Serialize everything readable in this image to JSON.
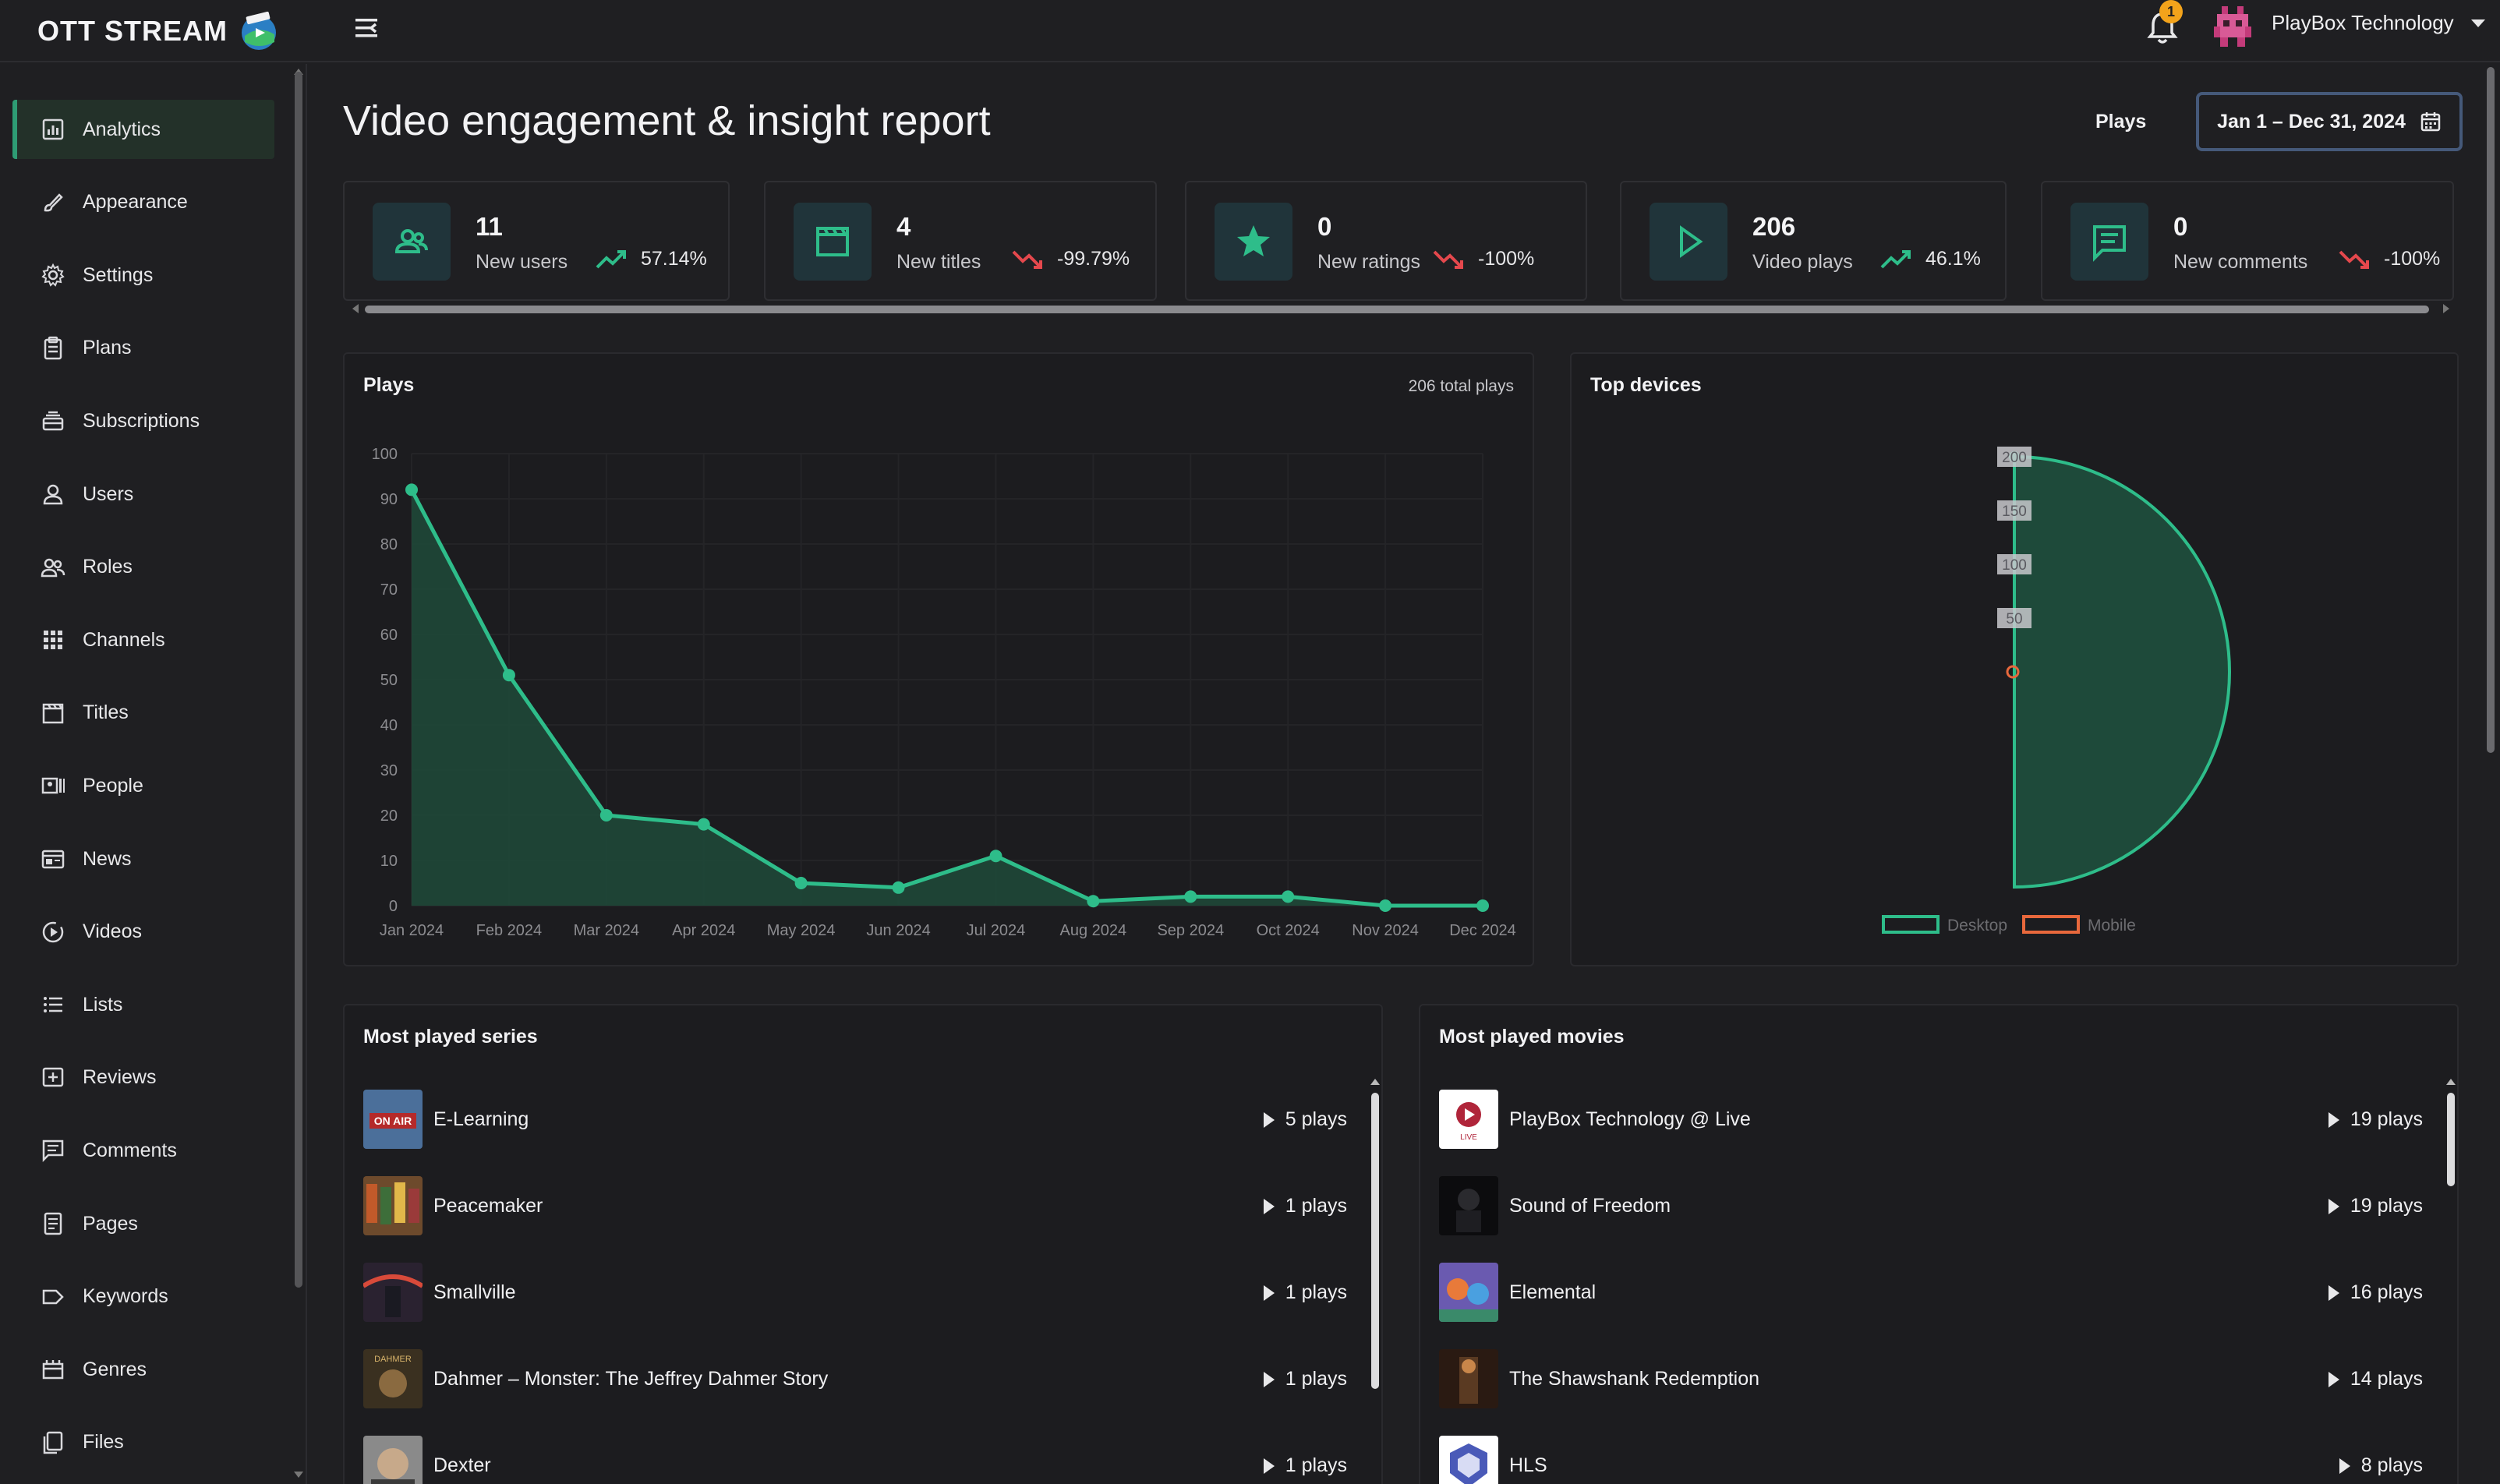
{
  "app": {
    "brand": "OTT STREAM",
    "notifications_count": "1",
    "account_name": "PlayBox Technology"
  },
  "sidebar": {
    "items": [
      {
        "label": "Analytics",
        "icon": "analytics-icon",
        "active": true
      },
      {
        "label": "Appearance",
        "icon": "brush-icon"
      },
      {
        "label": "Settings",
        "icon": "gear-icon"
      },
      {
        "label": "Plans",
        "icon": "clipboard-icon"
      },
      {
        "label": "Subscriptions",
        "icon": "stack-icon"
      },
      {
        "label": "Users",
        "icon": "user-icon"
      },
      {
        "label": "Roles",
        "icon": "users-icon"
      },
      {
        "label": "Channels",
        "icon": "grid-icon"
      },
      {
        "label": "Titles",
        "icon": "clapper-icon"
      },
      {
        "label": "People",
        "icon": "people-icon"
      },
      {
        "label": "News",
        "icon": "newspaper-icon"
      },
      {
        "label": "Videos",
        "icon": "video-icon"
      },
      {
        "label": "Lists",
        "icon": "list-icon"
      },
      {
        "label": "Reviews",
        "icon": "review-icon"
      },
      {
        "label": "Comments",
        "icon": "comment-icon"
      },
      {
        "label": "Pages",
        "icon": "page-icon"
      },
      {
        "label": "Keywords",
        "icon": "tag-icon"
      },
      {
        "label": "Genres",
        "icon": "genre-icon"
      },
      {
        "label": "Files",
        "icon": "files-icon"
      }
    ]
  },
  "header": {
    "title": "Video engagement & insight report",
    "metric_label": "Plays",
    "date_range": "Jan 1 – Dec 31, 2024"
  },
  "stats": [
    {
      "value": "11",
      "label": "New users",
      "trend": "57.14%",
      "direction": "up",
      "icon": "users-icon"
    },
    {
      "value": "4",
      "label": "New titles",
      "trend": "-99.79%",
      "direction": "down",
      "icon": "clapper-icon"
    },
    {
      "value": "0",
      "label": "New ratings",
      "trend": "-100%",
      "direction": "down",
      "icon": "star-icon"
    },
    {
      "value": "206",
      "label": "Video plays",
      "trend": "46.1%",
      "direction": "up",
      "icon": "play-icon"
    },
    {
      "value": "0",
      "label": "New comments",
      "trend": "-100%",
      "direction": "down",
      "icon": "comment-icon"
    }
  ],
  "colors": {
    "accent": "#2ebd8a",
    "down": "#e5484d",
    "up": "#2ebd8a",
    "mobile": "#e8683c"
  },
  "plays_panel": {
    "title": "Plays",
    "subtitle": "206 total plays"
  },
  "devices_panel": {
    "title": "Top devices"
  },
  "chart_data": [
    {
      "type": "area",
      "title": "Plays",
      "x": [
        "Jan 2024",
        "Feb 2024",
        "Mar 2024",
        "Apr 2024",
        "May 2024",
        "Jun 2024",
        "Jul 2024",
        "Aug 2024",
        "Sep 2024",
        "Oct 2024",
        "Nov 2024",
        "Dec 2024"
      ],
      "series": [
        {
          "values": [
            92,
            51,
            20,
            18,
            5,
            4,
            11,
            1,
            2,
            2,
            0,
            0
          ]
        }
      ],
      "ylim": [
        0,
        100
      ],
      "yticks": [
        0,
        10,
        20,
        30,
        40,
        50,
        60,
        70,
        80,
        90,
        100
      ],
      "grid": true
    },
    {
      "type": "radar",
      "title": "Top devices",
      "categories": [
        "Desktop",
        "Mobile"
      ],
      "values": [
        200,
        0
      ],
      "rticks": [
        50,
        100,
        150,
        200
      ],
      "legend": [
        {
          "name": "Desktop",
          "color": "#2ebd8a"
        },
        {
          "name": "Mobile",
          "color": "#e8683c"
        }
      ],
      "legend_position": "bottom"
    }
  ],
  "series_list": {
    "title": "Most played series",
    "items": [
      {
        "title": "E-Learning",
        "plays": "5 plays"
      },
      {
        "title": "Peacemaker",
        "plays": "1 plays"
      },
      {
        "title": "Smallville",
        "plays": "1 plays"
      },
      {
        "title": "Dahmer – Monster: The Jeffrey Dahmer Story",
        "plays": "1 plays"
      },
      {
        "title": "Dexter",
        "plays": "1 plays"
      }
    ]
  },
  "movies_list": {
    "title": "Most played movies",
    "items": [
      {
        "title": "PlayBox Technology @ Live",
        "plays": "19 plays"
      },
      {
        "title": "Sound of Freedom",
        "plays": "19 plays"
      },
      {
        "title": "Elemental",
        "plays": "16 plays"
      },
      {
        "title": "The Shawshank Redemption",
        "plays": "14 plays"
      },
      {
        "title": "HLS",
        "plays": "8 plays"
      }
    ]
  },
  "thumb_labels": {
    "on_air": "ON AIR",
    "dahmer": "DAHMER",
    "live": "LIVE"
  }
}
